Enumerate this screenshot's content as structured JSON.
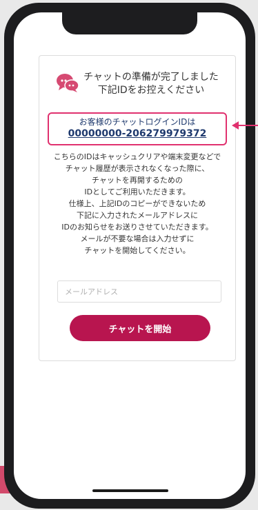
{
  "header": {
    "line1": "チャットの準備が完了しました",
    "line2": "下記IDをお控えください",
    "icon": "chat-bubbles-icon"
  },
  "chat_id": {
    "label": "お客様のチャットログインIDは",
    "value": "00000000-206279979372"
  },
  "description": [
    "こちらのIDはキャッシュクリアや端末変更などで",
    "チャット履歴が表示されなくなった際に、",
    "チャットを再開するための",
    "IDとしてご利用いただきます。",
    "仕様上、上記IDのコピーができないため",
    "下記に入力されたメールアドレスに",
    "IDのお知らせをお送りさせていただきます。",
    "メールが不要な場合は入力せずに",
    "チャットを開始してください。"
  ],
  "email": {
    "placeholder": "メールアドレス",
    "value": ""
  },
  "start_button": {
    "label": "チャットを開始"
  },
  "colors": {
    "accent": "#b8154f",
    "highlight_border": "#e0306e",
    "id_text": "#1f3a6e",
    "icon": "#d64a72"
  },
  "annotation": {
    "icon": "arrow-left-icon"
  }
}
